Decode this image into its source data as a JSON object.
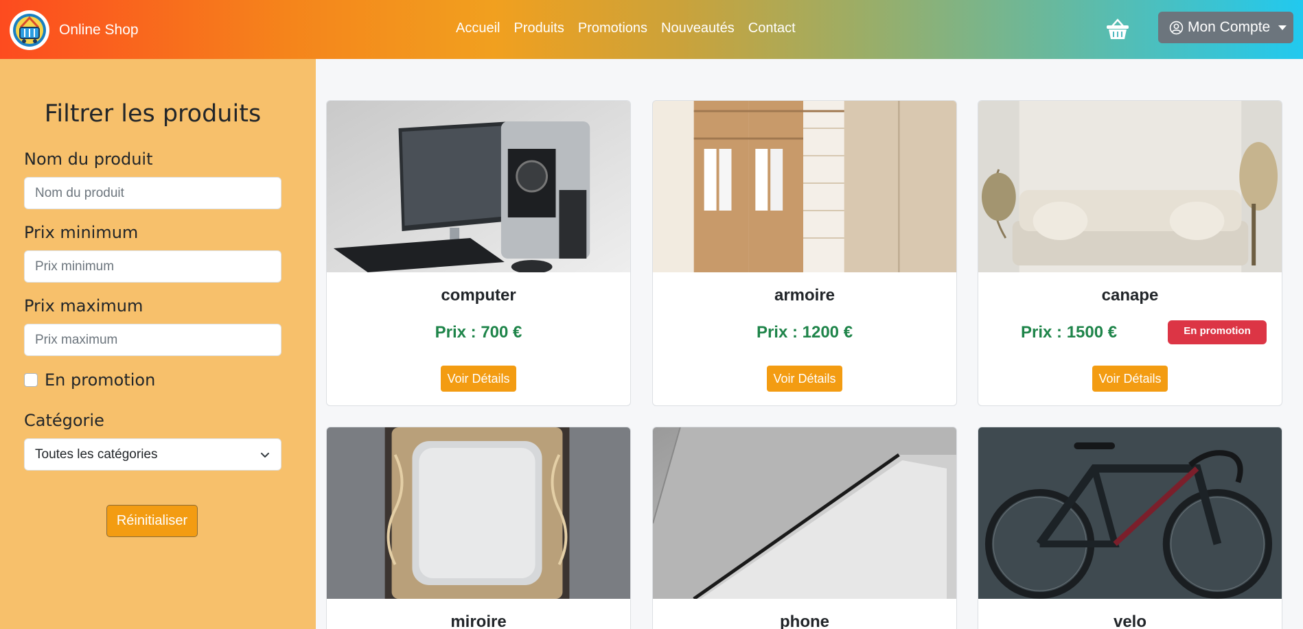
{
  "navbar": {
    "brand": "Online Shop",
    "links": [
      "Accueil",
      "Produits",
      "Promotions",
      "Nouveautés",
      "Contact"
    ],
    "account_label": "Mon Compte",
    "icons": {
      "logo": "shopping-basket-logo-icon",
      "cart": "basket-icon",
      "account": "user-circle-icon",
      "dropdown": "caret-down-icon"
    }
  },
  "filters": {
    "title": "Filtrer les produits",
    "name_label": "Nom du produit",
    "name_placeholder": "Nom du produit",
    "min_label": "Prix minimum",
    "min_placeholder": "Prix minimum",
    "max_label": "Prix maximum",
    "max_placeholder": "Prix maximum",
    "promo_label": "En promotion",
    "promo_checked": false,
    "category_label": "Catégorie",
    "category_value": "Toutes les catégories",
    "reset_label": "Réinitialiser"
  },
  "products": [
    {
      "name": "computer",
      "price": "Prix : 700 €",
      "promo": "",
      "button": "Voir Détails"
    },
    {
      "name": "armoire",
      "price": "Prix : 1200 €",
      "promo": "",
      "button": "Voir Détails"
    },
    {
      "name": "canape",
      "price": "Prix : 1500 €",
      "promo": "En promotion",
      "button": "Voir Détails"
    },
    {
      "name": "miroire",
      "price": "",
      "promo": "",
      "button": ""
    },
    {
      "name": "phone",
      "price": "",
      "promo": "",
      "button": ""
    },
    {
      "name": "velo",
      "price": "",
      "promo": "",
      "button": ""
    }
  ],
  "colors": {
    "accent": "#f39c12",
    "sidebar": "#f7c06b",
    "price": "#1e8449",
    "promo": "#dc3545"
  }
}
